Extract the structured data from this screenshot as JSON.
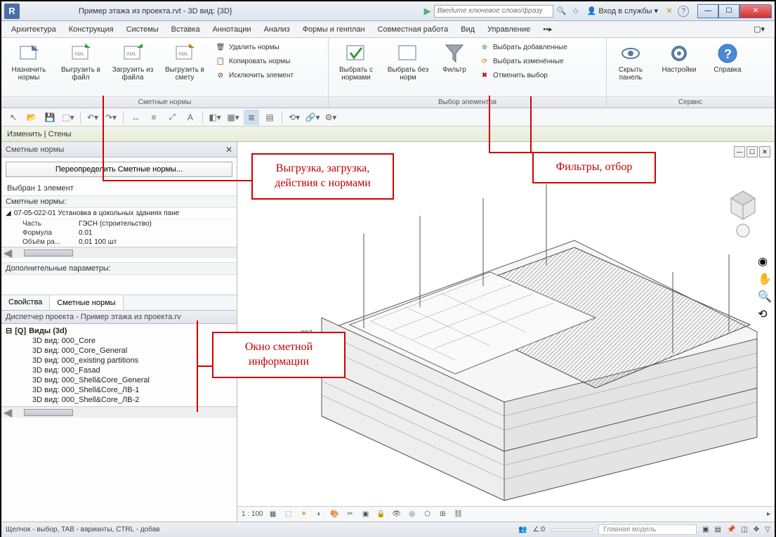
{
  "titlebar": {
    "logo_letter": "R",
    "title": "Пример этажа из проекта.rvt - 3D вид: {3D}",
    "search_placeholder": "Введите ключевое слово/фразу",
    "login_label": "Вход в службы"
  },
  "menu": {
    "items": [
      "Архитектура",
      "Конструкция",
      "Системы",
      "Вставка",
      "Аннотации",
      "Анализ",
      "Формы и генплан",
      "Совместная работа",
      "Вид",
      "Управление"
    ]
  },
  "ribbon": {
    "group1_title": "Сметные нормы",
    "group2_title": "Выбор элементов",
    "group3_title": "Сервис",
    "btn_assign": "Назначить нормы",
    "btn_export_file": "Выгрузить в файл",
    "btn_import_file": "Загрузить из файла",
    "btn_export_estimate": "Выгрузить в смету",
    "btn_delete": "Удалить  нормы",
    "btn_copy": "Копировать  нормы",
    "btn_exclude": "Исключить  элемент",
    "btn_select_with": "Выбрать с нормами",
    "btn_select_without": "Выбрать без норм",
    "btn_filter": "Фильтр",
    "btn_select_added": "Выбрать добавленные",
    "btn_select_changed": "Выбрать изменённые",
    "btn_cancel_select": "Отменить выбор",
    "btn_hide_panel": "Скрыть панель",
    "btn_settings": "Настройки",
    "btn_help": "Справка"
  },
  "context": {
    "text": "Изменить | Стены"
  },
  "panel": {
    "title": "Сметные нормы",
    "override_btn": "Переопределить Сметные нормы...",
    "selection": "Выбран 1 элемент",
    "norms_label": "Сметные нормы:",
    "norm_code": "07-05-022-01 Установка в цокольных зданиях пане",
    "rows": [
      {
        "key": "Часть",
        "val": "ГЭСН (строительство)"
      },
      {
        "key": "Формула",
        "val": "0.01"
      },
      {
        "key": "Объём ра...",
        "val": "0,01 100 шт"
      }
    ],
    "extra_label": "Дополнительные параметры:",
    "tab_props": "Свойства",
    "tab_norms": "Сметные нормы"
  },
  "browser": {
    "title": "Диспетчер проекта - Пример этажа из проекта.rv",
    "root": "Виды (3d)",
    "children": [
      "3D вид: 000_Core",
      "3D вид: 000_Core_General",
      "3D вид: 000_existing partitions",
      "3D вид: 000_Fasad",
      "3D вид: 000_Shell&Core_General",
      "3D вид: 000_Shell&Core_ЛВ-1",
      "3D вид: 000_Shell&Core_ЛВ-2"
    ]
  },
  "viewbar": {
    "scale": "1 : 100"
  },
  "status": {
    "hint": "Щелчок - выбор, TAB - варианты, CTRL - добав",
    "angle": "0",
    "model": "Главная модель"
  },
  "callouts": {
    "c1": "Выгрузка, загрузка, действия с нормами",
    "c2": "Фильтры, отбор",
    "c3": "Окно сметной информации"
  },
  "view_dim": "297"
}
